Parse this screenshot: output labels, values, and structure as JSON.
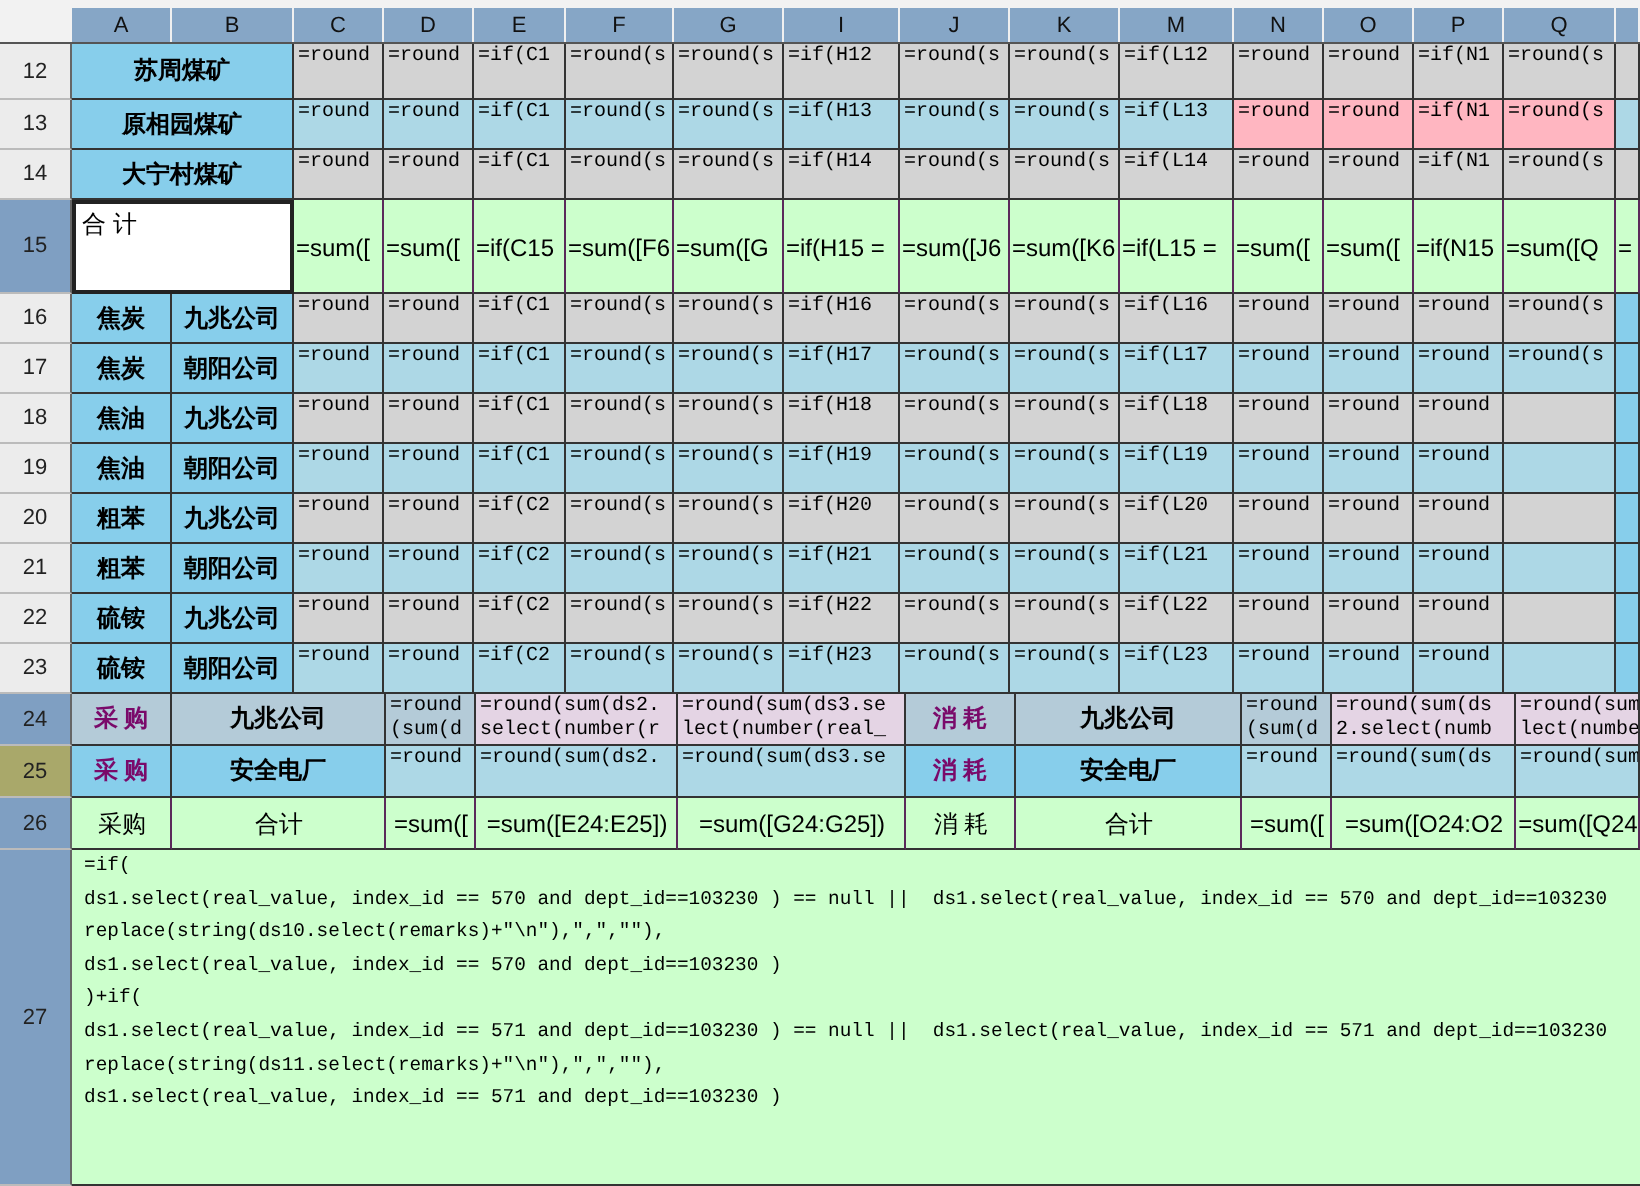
{
  "columns": [
    "A",
    "B",
    "C",
    "D",
    "E",
    "F",
    "G",
    "I",
    "J",
    "K",
    "M",
    "N",
    "O",
    "P",
    "Q"
  ],
  "rows": [
    {
      "header": {
        "label": "12",
        "color": "#ececec"
      },
      "kind": "mine",
      "color": "#d3d3d3",
      "cells": [
        {
          "text": "苏周煤矿",
          "kind": "label",
          "color": "#87ceeb"
        },
        {
          "text": "=round",
          "kind": "formula"
        },
        {
          "text": "=round",
          "kind": "formula"
        },
        {
          "text": "=if(C1",
          "kind": "formula"
        },
        {
          "text": "=round(s",
          "kind": "formula"
        },
        {
          "text": "=round(s",
          "kind": "formula"
        },
        {
          "text": "=if(H12",
          "kind": "formula"
        },
        {
          "text": "=round(s",
          "kind": "formula"
        },
        {
          "text": "=round(s",
          "kind": "formula"
        },
        {
          "text": "=if(L12",
          "kind": "formula"
        },
        {
          "text": "=round",
          "kind": "formula"
        },
        {
          "text": "=round",
          "kind": "formula"
        },
        {
          "text": "=if(N1",
          "kind": "formula"
        },
        {
          "text": "=round(s",
          "kind": "formula"
        }
      ]
    },
    {
      "header": {
        "label": "13",
        "color": "#ececec"
      },
      "kind": "mine",
      "color": "#add8e6",
      "cells": [
        {
          "text": "原相园煤矿",
          "kind": "label",
          "color": "#87ceeb"
        },
        {
          "text": "=round",
          "kind": "formula"
        },
        {
          "text": "=round",
          "kind": "formula"
        },
        {
          "text": "=if(C1",
          "kind": "formula"
        },
        {
          "text": "=round(s",
          "kind": "formula"
        },
        {
          "text": "=round(s",
          "kind": "formula"
        },
        {
          "text": "=if(H13",
          "kind": "formula"
        },
        {
          "text": "=round(s",
          "kind": "formula"
        },
        {
          "text": "=round(s",
          "kind": "formula"
        },
        {
          "text": "=if(L13",
          "kind": "formula"
        },
        {
          "text": "=round",
          "kind": "formula",
          "color": "#ffb6c1"
        },
        {
          "text": "=round",
          "kind": "formula",
          "color": "#ffb6c1"
        },
        {
          "text": "=if(N1",
          "kind": "formula",
          "color": "#ffb6c1"
        },
        {
          "text": "=round(s",
          "kind": "formula",
          "color": "#ffb6c1"
        }
      ]
    },
    {
      "header": {
        "label": "14",
        "color": "#ececec"
      },
      "kind": "mine",
      "color": "#d3d3d3",
      "cells": [
        {
          "text": "大宁村煤矿",
          "kind": "label",
          "color": "#87ceeb"
        },
        {
          "text": "=round",
          "kind": "formula"
        },
        {
          "text": "=round",
          "kind": "formula"
        },
        {
          "text": "=if(C1",
          "kind": "formula"
        },
        {
          "text": "=round(s",
          "kind": "formula"
        },
        {
          "text": "=round(s",
          "kind": "formula"
        },
        {
          "text": "=if(H14",
          "kind": "formula"
        },
        {
          "text": "=round(s",
          "kind": "formula"
        },
        {
          "text": "=round(s",
          "kind": "formula"
        },
        {
          "text": "=if(L14",
          "kind": "formula"
        },
        {
          "text": "=round",
          "kind": "formula"
        },
        {
          "text": "=round",
          "kind": "formula"
        },
        {
          "text": "=if(N1",
          "kind": "formula"
        },
        {
          "text": "=round(s",
          "kind": "formula"
        }
      ]
    },
    {
      "header": {
        "label": "15",
        "color": "#7f9fc2"
      },
      "kind": "total",
      "color": "#ccffcc",
      "cells": [
        {
          "text": "合 计",
          "kind": "total",
          "color": "#ffffff"
        },
        {
          "text": "=sum([",
          "kind": "sum"
        },
        {
          "text": "=sum([",
          "kind": "sum"
        },
        {
          "text": "=if(C15",
          "kind": "sum"
        },
        {
          "text": "=sum([F6",
          "kind": "sum"
        },
        {
          "text": "=sum([G",
          "kind": "sum"
        },
        {
          "text": "=if(H15 =",
          "kind": "sum"
        },
        {
          "text": "=sum([J6",
          "kind": "sum"
        },
        {
          "text": "=sum([K6",
          "kind": "sum"
        },
        {
          "text": "=if(L15 =",
          "kind": "sum"
        },
        {
          "text": "=sum([",
          "kind": "sum"
        },
        {
          "text": "=sum([",
          "kind": "sum"
        },
        {
          "text": "=if(N15",
          "kind": "sum"
        },
        {
          "text": "=sum([Q",
          "kind": "sum"
        },
        {
          "text": "=",
          "kind": "sum"
        }
      ]
    },
    {
      "header": {
        "label": "16",
        "color": "#ececec"
      },
      "kind": "product",
      "color": "#d3d3d3",
      "cells": [
        {
          "text": "焦炭",
          "kind": "label",
          "color": "#87ceeb"
        },
        {
          "text": "九兆公司",
          "kind": "label",
          "color": "#87ceeb"
        },
        {
          "text": "=round",
          "kind": "formula"
        },
        {
          "text": "=round",
          "kind": "formula"
        },
        {
          "text": "=if(C1",
          "kind": "formula"
        },
        {
          "text": "=round(s",
          "kind": "formula"
        },
        {
          "text": "=round(s",
          "kind": "formula"
        },
        {
          "text": "=if(H16",
          "kind": "formula"
        },
        {
          "text": "=round(s",
          "kind": "formula"
        },
        {
          "text": "=round(s",
          "kind": "formula"
        },
        {
          "text": "=if(L16",
          "kind": "formula"
        },
        {
          "text": "=round",
          "kind": "formula"
        },
        {
          "text": "=round",
          "kind": "formula"
        },
        {
          "text": "=round",
          "kind": "formula"
        },
        {
          "text": "=round(s",
          "kind": "formula"
        },
        {
          "text": "",
          "kind": "formula",
          "color": "#87ceeb"
        }
      ]
    },
    {
      "header": {
        "label": "17",
        "color": "#ececec"
      },
      "kind": "product",
      "color": "#add8e6",
      "cells": [
        {
          "text": "焦炭",
          "kind": "label",
          "color": "#87ceeb"
        },
        {
          "text": "朝阳公司",
          "kind": "label",
          "color": "#87ceeb"
        },
        {
          "text": "=round",
          "kind": "formula"
        },
        {
          "text": "=round",
          "kind": "formula"
        },
        {
          "text": "=if(C1",
          "kind": "formula"
        },
        {
          "text": "=round(s",
          "kind": "formula"
        },
        {
          "text": "=round(s",
          "kind": "formula"
        },
        {
          "text": "=if(H17",
          "kind": "formula"
        },
        {
          "text": "=round(s",
          "kind": "formula"
        },
        {
          "text": "=round(s",
          "kind": "formula"
        },
        {
          "text": "=if(L17",
          "kind": "formula"
        },
        {
          "text": "=round",
          "kind": "formula"
        },
        {
          "text": "=round",
          "kind": "formula"
        },
        {
          "text": "=round",
          "kind": "formula"
        },
        {
          "text": "=round(s",
          "kind": "formula"
        },
        {
          "text": "",
          "kind": "formula",
          "color": "#87ceeb"
        }
      ]
    },
    {
      "header": {
        "label": "18",
        "color": "#ececec"
      },
      "kind": "product",
      "color": "#d3d3d3",
      "cells": [
        {
          "text": "焦油",
          "kind": "label",
          "color": "#87ceeb"
        },
        {
          "text": "九兆公司",
          "kind": "label",
          "color": "#87ceeb"
        },
        {
          "text": "=round",
          "kind": "formula"
        },
        {
          "text": "=round",
          "kind": "formula"
        },
        {
          "text": "=if(C1",
          "kind": "formula"
        },
        {
          "text": "=round(s",
          "kind": "formula"
        },
        {
          "text": "=round(s",
          "kind": "formula"
        },
        {
          "text": "=if(H18",
          "kind": "formula"
        },
        {
          "text": "=round(s",
          "kind": "formula"
        },
        {
          "text": "=round(s",
          "kind": "formula"
        },
        {
          "text": "=if(L18",
          "kind": "formula"
        },
        {
          "text": "=round",
          "kind": "formula"
        },
        {
          "text": "=round",
          "kind": "formula"
        },
        {
          "text": "=round",
          "kind": "formula"
        },
        {
          "text": "",
          "kind": "formula"
        },
        {
          "text": "",
          "kind": "formula",
          "color": "#87ceeb"
        }
      ]
    },
    {
      "header": {
        "label": "19",
        "color": "#ececec"
      },
      "kind": "product",
      "color": "#add8e6",
      "cells": [
        {
          "text": "焦油",
          "kind": "label",
          "color": "#87ceeb"
        },
        {
          "text": "朝阳公司",
          "kind": "label",
          "color": "#87ceeb"
        },
        {
          "text": "=round",
          "kind": "formula"
        },
        {
          "text": "=round",
          "kind": "formula"
        },
        {
          "text": "=if(C1",
          "kind": "formula"
        },
        {
          "text": "=round(s",
          "kind": "formula"
        },
        {
          "text": "=round(s",
          "kind": "formula"
        },
        {
          "text": "=if(H19",
          "kind": "formula"
        },
        {
          "text": "=round(s",
          "kind": "formula"
        },
        {
          "text": "=round(s",
          "kind": "formula"
        },
        {
          "text": "=if(L19",
          "kind": "formula"
        },
        {
          "text": "=round",
          "kind": "formula"
        },
        {
          "text": "=round",
          "kind": "formula"
        },
        {
          "text": "=round",
          "kind": "formula"
        },
        {
          "text": "",
          "kind": "formula"
        },
        {
          "text": "",
          "kind": "formula",
          "color": "#87ceeb"
        }
      ]
    },
    {
      "header": {
        "label": "20",
        "color": "#ececec"
      },
      "kind": "product",
      "color": "#d3d3d3",
      "cells": [
        {
          "text": "粗苯",
          "kind": "label",
          "color": "#87ceeb"
        },
        {
          "text": "九兆公司",
          "kind": "label",
          "color": "#87ceeb"
        },
        {
          "text": "=round",
          "kind": "formula"
        },
        {
          "text": "=round",
          "kind": "formula"
        },
        {
          "text": "=if(C2",
          "kind": "formula"
        },
        {
          "text": "=round(s",
          "kind": "formula"
        },
        {
          "text": "=round(s",
          "kind": "formula"
        },
        {
          "text": "=if(H20",
          "kind": "formula"
        },
        {
          "text": "=round(s",
          "kind": "formula"
        },
        {
          "text": "=round(s",
          "kind": "formula"
        },
        {
          "text": "=if(L20",
          "kind": "formula"
        },
        {
          "text": "=round",
          "kind": "formula"
        },
        {
          "text": "=round",
          "kind": "formula"
        },
        {
          "text": "=round",
          "kind": "formula"
        },
        {
          "text": "",
          "kind": "formula"
        },
        {
          "text": "",
          "kind": "formula",
          "color": "#87ceeb"
        }
      ]
    },
    {
      "header": {
        "label": "21",
        "color": "#ececec"
      },
      "kind": "product",
      "color": "#add8e6",
      "cells": [
        {
          "text": "粗苯",
          "kind": "label",
          "color": "#87ceeb"
        },
        {
          "text": "朝阳公司",
          "kind": "label",
          "color": "#87ceeb"
        },
        {
          "text": "=round",
          "kind": "formula"
        },
        {
          "text": "=round",
          "kind": "formula"
        },
        {
          "text": "=if(C2",
          "kind": "formula"
        },
        {
          "text": "=round(s",
          "kind": "formula"
        },
        {
          "text": "=round(s",
          "kind": "formula"
        },
        {
          "text": "=if(H21",
          "kind": "formula"
        },
        {
          "text": "=round(s",
          "kind": "formula"
        },
        {
          "text": "=round(s",
          "kind": "formula"
        },
        {
          "text": "=if(L21",
          "kind": "formula"
        },
        {
          "text": "=round",
          "kind": "formula"
        },
        {
          "text": "=round",
          "kind": "formula"
        },
        {
          "text": "=round",
          "kind": "formula"
        },
        {
          "text": "",
          "kind": "formula"
        },
        {
          "text": "",
          "kind": "formula",
          "color": "#87ceeb"
        }
      ]
    },
    {
      "header": {
        "label": "22",
        "color": "#ececec"
      },
      "kind": "product",
      "color": "#d3d3d3",
      "cells": [
        {
          "text": "硫铵",
          "kind": "label",
          "color": "#87ceeb"
        },
        {
          "text": "九兆公司",
          "kind": "label",
          "color": "#87ceeb"
        },
        {
          "text": "=round",
          "kind": "formula"
        },
        {
          "text": "=round",
          "kind": "formula"
        },
        {
          "text": "=if(C2",
          "kind": "formula"
        },
        {
          "text": "=round(s",
          "kind": "formula"
        },
        {
          "text": "=round(s",
          "kind": "formula"
        },
        {
          "text": "=if(H22",
          "kind": "formula"
        },
        {
          "text": "=round(s",
          "kind": "formula"
        },
        {
          "text": "=round(s",
          "kind": "formula"
        },
        {
          "text": "=if(L22",
          "kind": "formula"
        },
        {
          "text": "=round",
          "kind": "formula"
        },
        {
          "text": "=round",
          "kind": "formula"
        },
        {
          "text": "=round",
          "kind": "formula"
        },
        {
          "text": "",
          "kind": "formula"
        },
        {
          "text": "",
          "kind": "formula",
          "color": "#87ceeb"
        }
      ]
    },
    {
      "header": {
        "label": "23",
        "color": "#ececec"
      },
      "kind": "product",
      "color": "#add8e6",
      "cells": [
        {
          "text": "硫铵",
          "kind": "label",
          "color": "#87ceeb"
        },
        {
          "text": "朝阳公司",
          "kind": "label",
          "color": "#87ceeb"
        },
        {
          "text": "=round",
          "kind": "formula"
        },
        {
          "text": "=round",
          "kind": "formula"
        },
        {
          "text": "=if(C2",
          "kind": "formula"
        },
        {
          "text": "=round(s",
          "kind": "formula"
        },
        {
          "text": "=round(s",
          "kind": "formula"
        },
        {
          "text": "=if(H23",
          "kind": "formula"
        },
        {
          "text": "=round(s",
          "kind": "formula"
        },
        {
          "text": "=round(s",
          "kind": "formula"
        },
        {
          "text": "=if(L23",
          "kind": "formula"
        },
        {
          "text": "=round",
          "kind": "formula"
        },
        {
          "text": "=round",
          "kind": "formula"
        },
        {
          "text": "=round",
          "kind": "formula"
        },
        {
          "text": "",
          "kind": "formula"
        },
        {
          "text": "",
          "kind": "formula",
          "color": "#87ceeb"
        }
      ]
    },
    {
      "header": {
        "label": "24",
        "color": "#7f9fc2"
      },
      "kind": "trade",
      "color": "#e4d4e4",
      "cells": [
        {
          "text": "采 购",
          "kind": "accent",
          "color": "#b4cbd8"
        },
        {
          "text": "九兆公司",
          "kind": "label",
          "color": "#b4cbd8"
        },
        {
          "text": "=round\n(sum(d",
          "kind": "formula",
          "color": "#b4cbd8"
        },
        {
          "text": "=round(sum(ds2.\nselect(number(r",
          "kind": "formula"
        },
        {
          "text": "=round(sum(ds3.se\nlect(number(real_",
          "kind": "formula"
        },
        {
          "text": "消 耗",
          "kind": "accent",
          "color": "#b4cbd8"
        },
        {
          "text": "九兆公司",
          "kind": "label",
          "color": "#b4cbd8"
        },
        {
          "text": "=round\n(sum(d",
          "kind": "formula",
          "color": "#b4cbd8"
        },
        {
          "text": "=round(sum(ds\n2.select(numb",
          "kind": "formula"
        },
        {
          "text": "=round(sum\nlect(numbe",
          "kind": "formula"
        }
      ]
    },
    {
      "header": {
        "label": "25",
        "color": "#a9a86a"
      },
      "kind": "trade",
      "color": "#add8e6",
      "cells": [
        {
          "text": "采 购",
          "kind": "accent",
          "color": "#87ceeb"
        },
        {
          "text": "安全电厂",
          "kind": "label",
          "color": "#87ceeb"
        },
        {
          "text": "=round",
          "kind": "formula"
        },
        {
          "text": "=round(sum(ds2.",
          "kind": "formula"
        },
        {
          "text": "=round(sum(ds3.se",
          "kind": "formula"
        },
        {
          "text": "消 耗",
          "kind": "accent",
          "color": "#87ceeb"
        },
        {
          "text": "安全电厂",
          "kind": "label",
          "color": "#87ceeb"
        },
        {
          "text": "=round",
          "kind": "formula"
        },
        {
          "text": "=round(sum(ds",
          "kind": "formula"
        },
        {
          "text": "=round(sum",
          "kind": "formula"
        }
      ]
    },
    {
      "header": {
        "label": "26",
        "color": "#7f9fc2"
      },
      "kind": "trade",
      "color": "#ccffcc",
      "cells": [
        {
          "text": "采购",
          "kind": "center"
        },
        {
          "text": "合计",
          "kind": "center"
        },
        {
          "text": "=sum([",
          "kind": "center"
        },
        {
          "text": "=sum([E24:E25])",
          "kind": "center"
        },
        {
          "text": "=sum([G24:G25])",
          "kind": "center"
        },
        {
          "text": "消 耗",
          "kind": "center"
        },
        {
          "text": "合计",
          "kind": "center"
        },
        {
          "text": "=sum([",
          "kind": "center"
        },
        {
          "text": "=sum([O24:O2",
          "kind": "center"
        },
        {
          "text": "=sum([Q24",
          "kind": "center"
        }
      ]
    },
    {
      "header": {
        "label": "27",
        "color": "#7f9fc2"
      },
      "kind": "note",
      "color": "#ccffcc",
      "cells": [
        {
          "kind": "code",
          "lines": [
            "=if(",
            "ds1.select(real_value, index_id == 570 and dept_id==103230 ) == null ||  ds1.select(real_value, index_id == 570 and dept_id==103230",
            "replace(string(ds10.select(remarks)+\"\\n\"),\",\",\"\"),",
            "ds1.select(real_value, index_id == 570 and dept_id==103230 )",
            ")+if(",
            "ds1.select(real_value, index_id == 571 and dept_id==103230 ) == null ||  ds1.select(real_value, index_id == 571 and dept_id==103230",
            "replace(string(ds11.select(remarks)+\"\\n\"),\",\",\"\"),",
            "ds1.select(real_value, index_id == 571 and dept_id==103230 )"
          ]
        }
      ]
    }
  ]
}
